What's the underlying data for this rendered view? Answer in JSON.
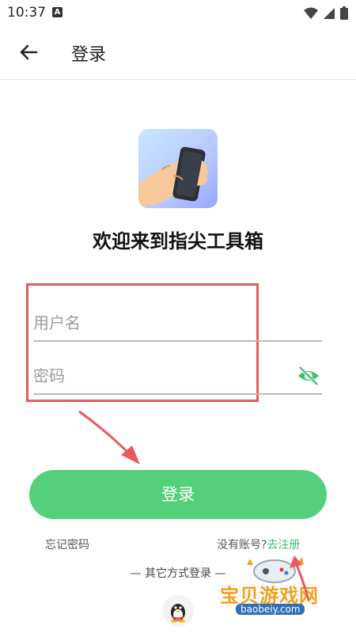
{
  "status_bar": {
    "time": "10:37",
    "app_badge": "A"
  },
  "appbar": {
    "title": "登录"
  },
  "welcome_text": "欢迎来到指尖工具箱",
  "form": {
    "username_placeholder": "用户名",
    "password_placeholder": "密码"
  },
  "login_button": "登录",
  "links": {
    "forgot": "忘记密码",
    "no_account": "没有账号?",
    "register": "去注册"
  },
  "other_login_title": "— 其它方式登录 —",
  "watermark": {
    "brand": "宝贝游戏网",
    "url": "baobeiy.com"
  },
  "colors": {
    "primary": "#54cf7c",
    "annotation": "#e75a5f",
    "link": "#3bbf67"
  }
}
